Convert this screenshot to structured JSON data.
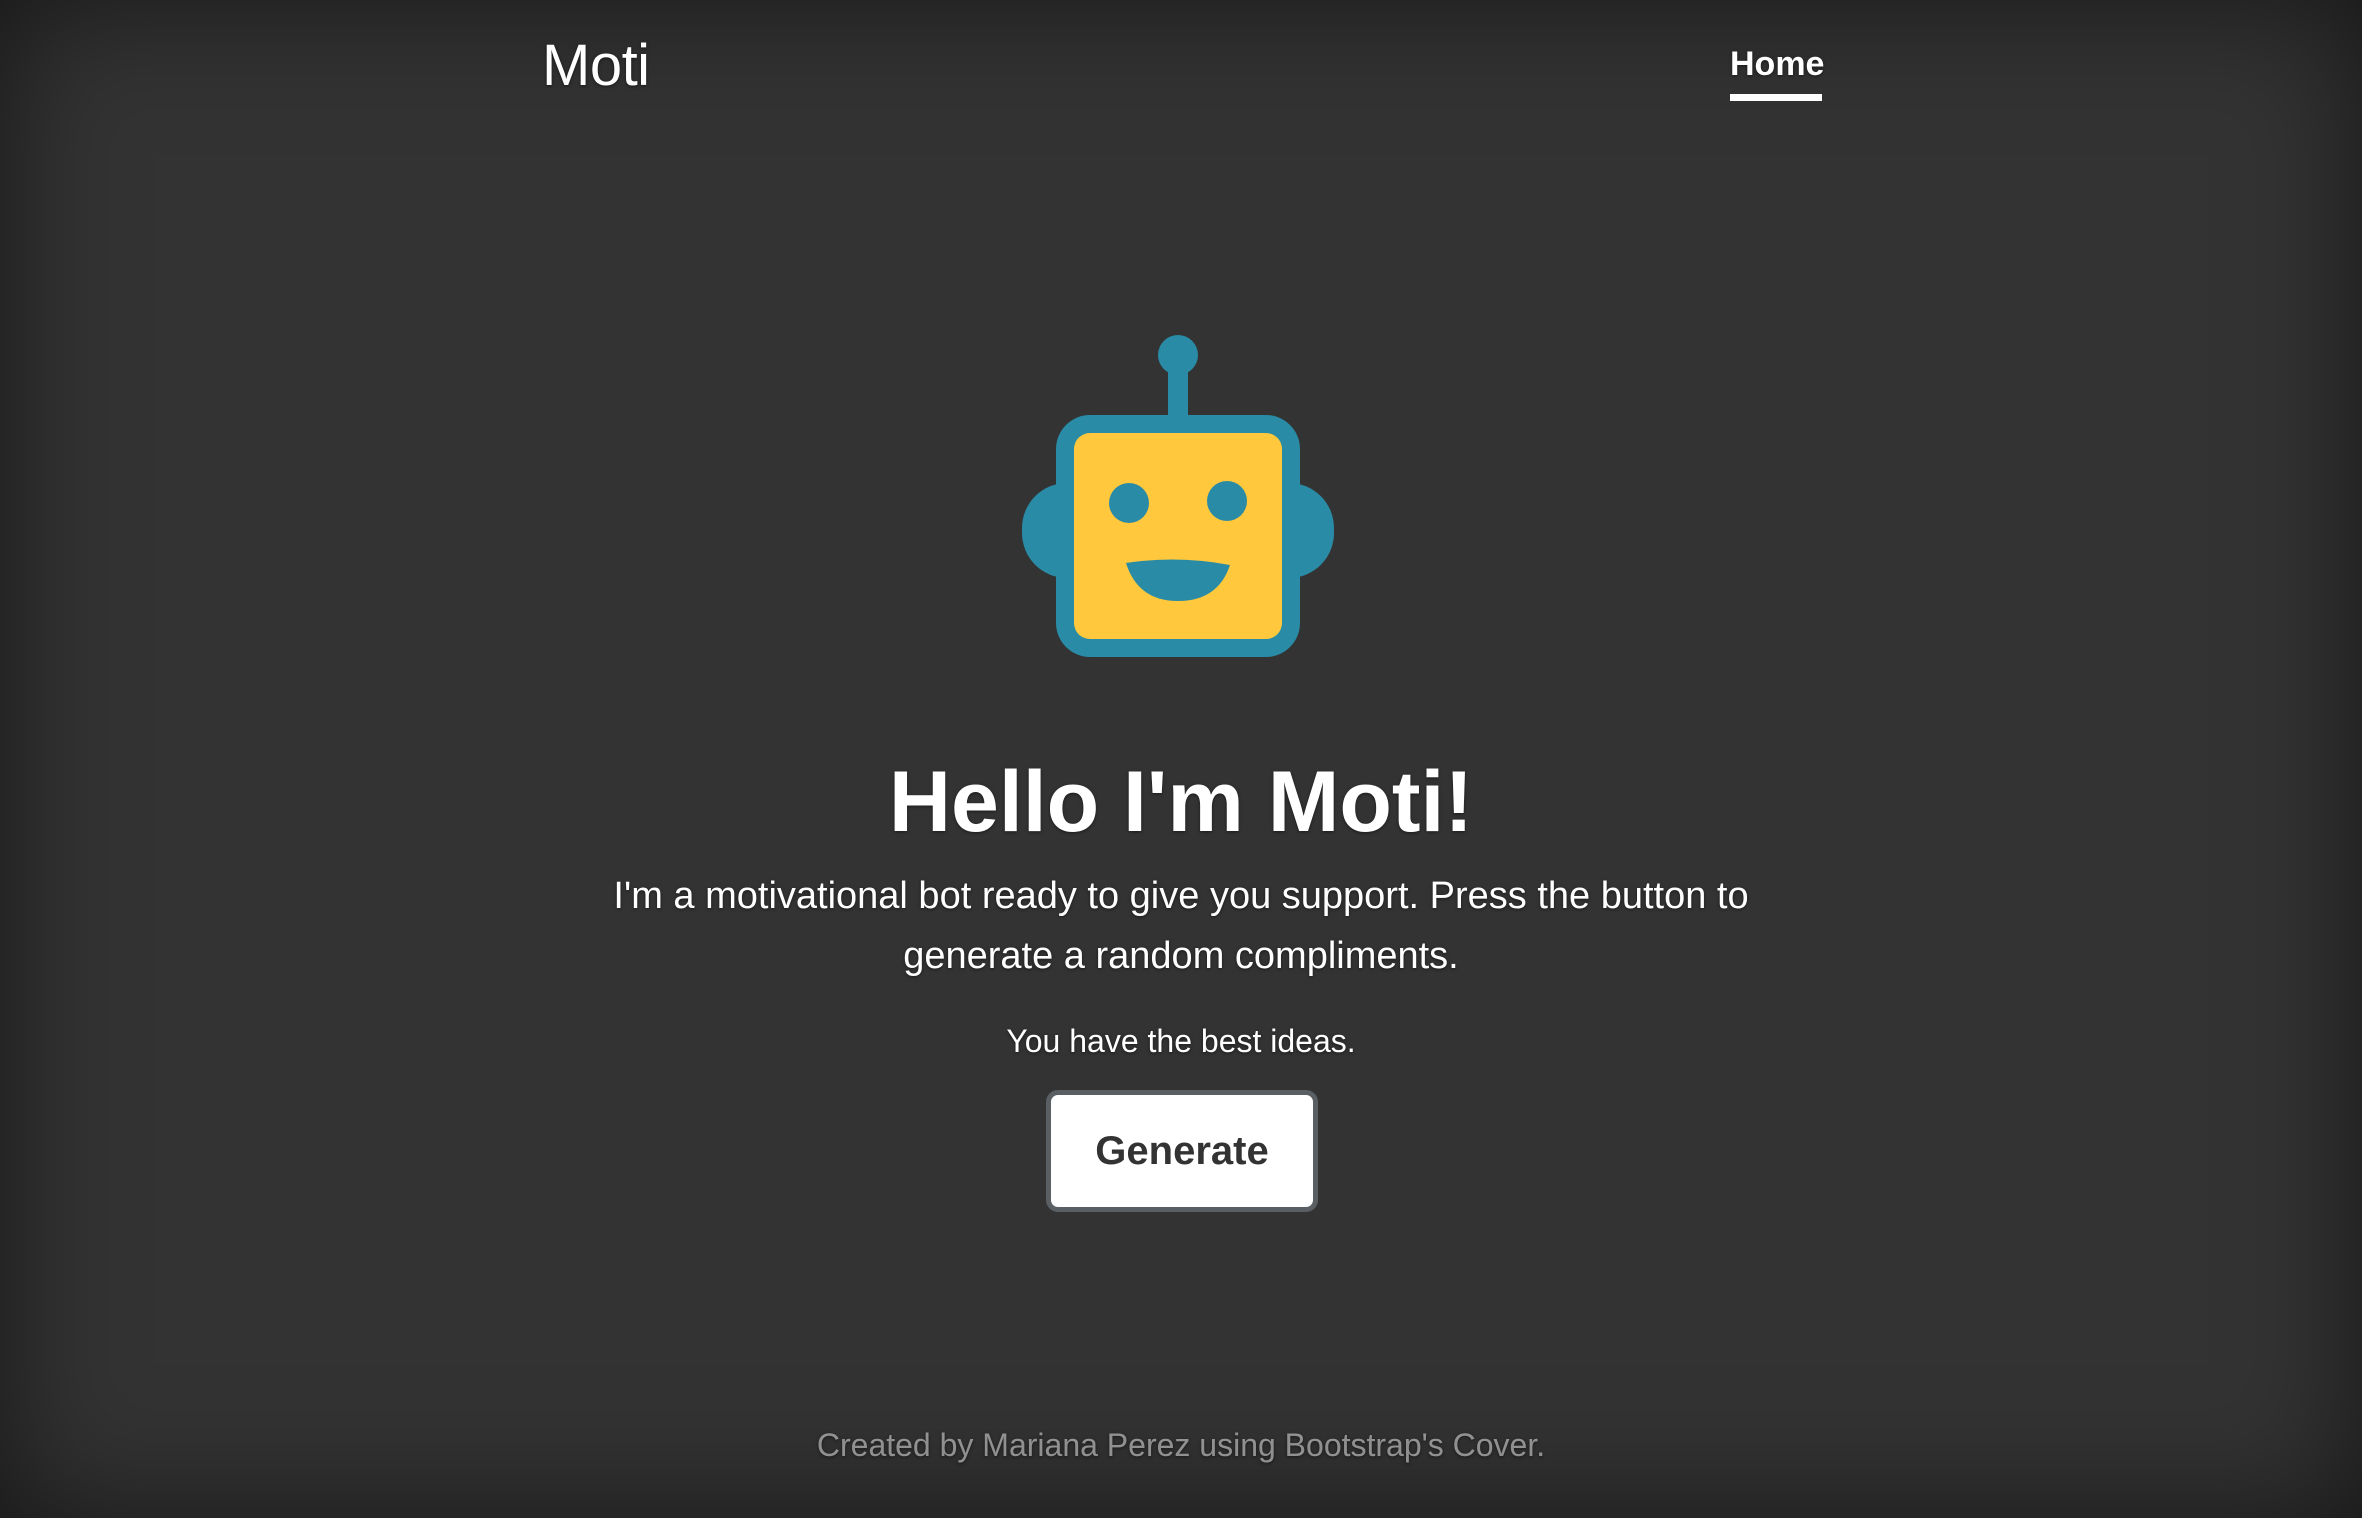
{
  "header": {
    "brand": "Moti",
    "nav": [
      {
        "label": "Home",
        "active": true
      }
    ]
  },
  "hero": {
    "icon": "robot-icon",
    "title": "Hello I'm Moti!",
    "lead": "I'm a motivational bot ready to give you support. Press the button to generate a random compliments.",
    "compliment": "You have the best ideas.",
    "button_label": "Generate"
  },
  "footer": {
    "text": "Created by Mariana Perez using Bootstrap's Cover."
  },
  "colors": {
    "background": "#333333",
    "robot_face": "#FFC83D",
    "robot_frame": "#2A8BA6",
    "text": "#FFFFFF",
    "button_border": "#5A5F64"
  }
}
